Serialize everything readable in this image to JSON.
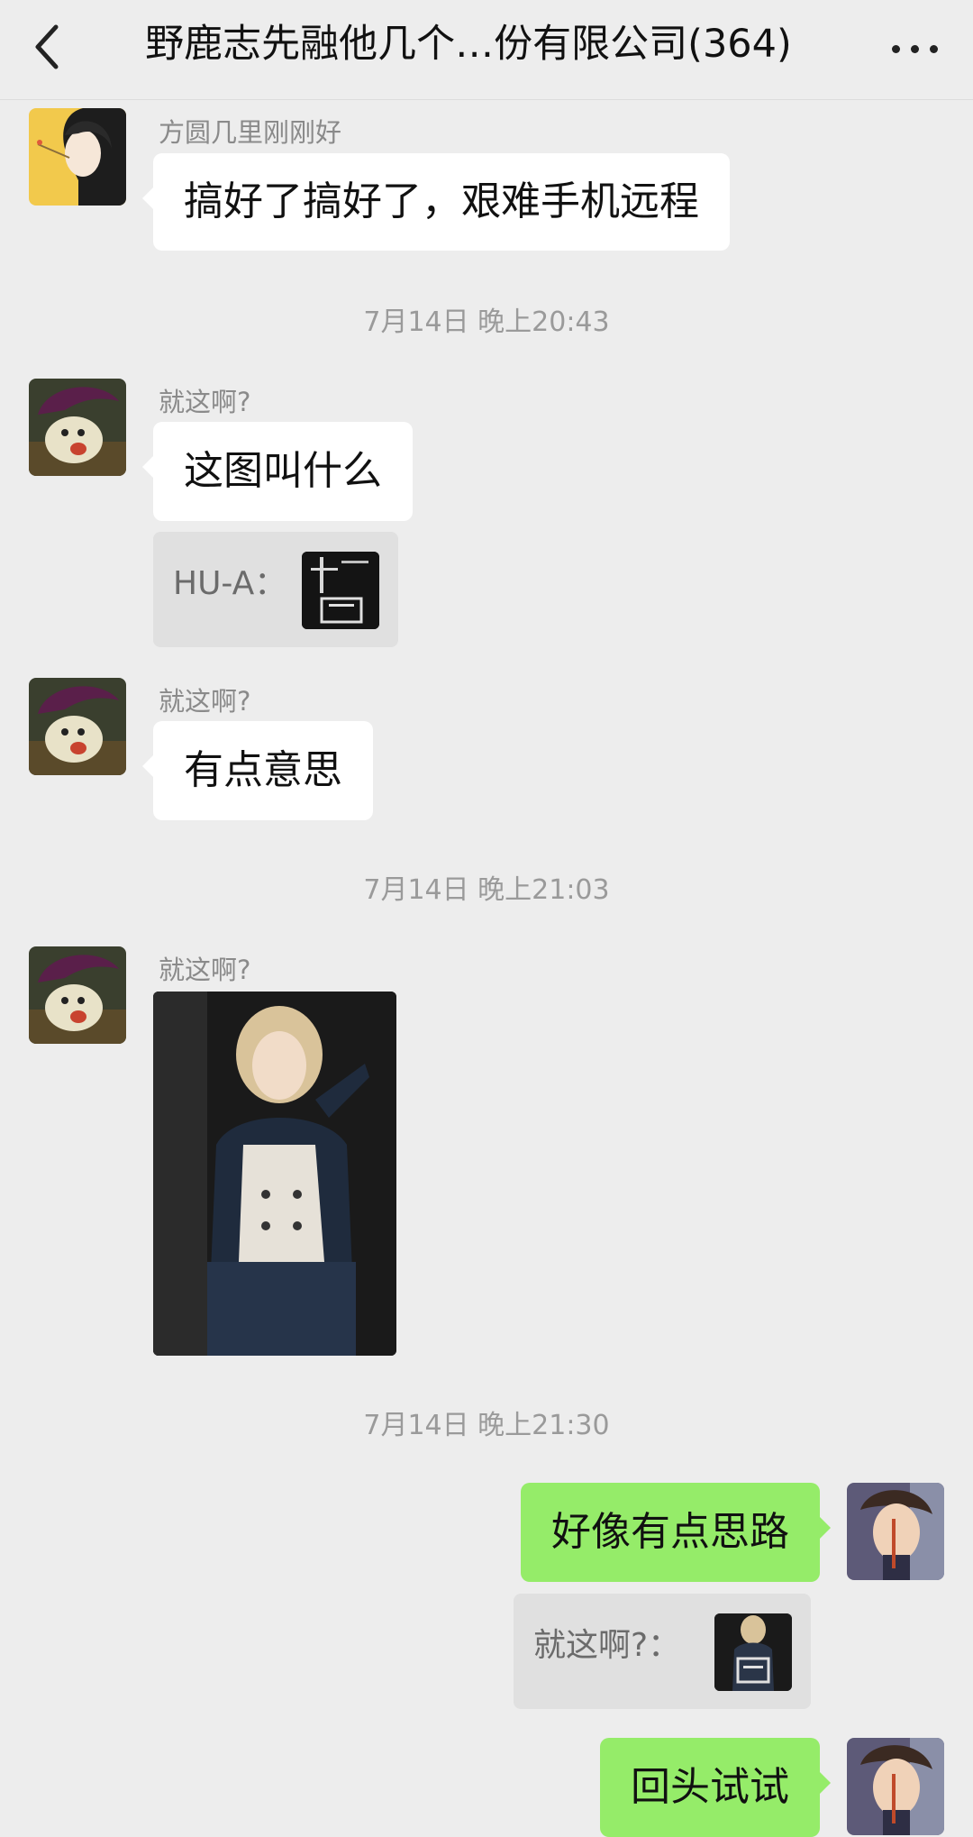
{
  "header": {
    "title": "野鹿志先融他几个…份有限公司(364)",
    "back_icon": "chevron-left-icon",
    "more_icon": "more-dots-icon"
  },
  "messages": [
    {
      "sender": "方圆几里刚刚好",
      "text": "搞好了搞好了，艰难手机远程"
    },
    {
      "time": "7月14日 晚上20:43"
    },
    {
      "sender": "就这啊?",
      "text": "这图叫什么",
      "quote": "HU-A："
    },
    {
      "sender": "就这啊?",
      "text": "有点意思"
    },
    {
      "time": "7月14日 晚上21:03"
    },
    {
      "sender": "就这啊?",
      "image": "photo-message"
    },
    {
      "time": "7月14日 晚上21:30"
    },
    {
      "self": true,
      "text": "好像有点思路",
      "quote": "就这啊?："
    },
    {
      "self": true,
      "text": "回头试试"
    }
  ],
  "colors": {
    "background": "#ededed",
    "self_bubble": "#95ec69",
    "other_bubble": "#ffffff",
    "quote_bg": "#e0e0e0"
  }
}
